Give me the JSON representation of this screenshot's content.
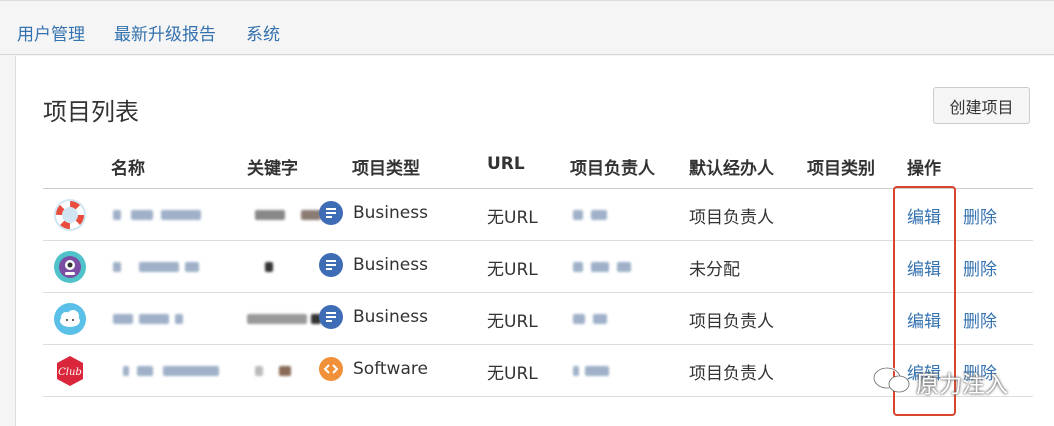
{
  "nav": {
    "items": [
      {
        "label": "用户管理"
      },
      {
        "label": "最新升级报告"
      },
      {
        "label": "系统"
      }
    ]
  },
  "page": {
    "title": "项目列表",
    "create_button": "创建项目"
  },
  "table": {
    "headers": {
      "name": "名称",
      "key": "关键字",
      "type": "项目类型",
      "url": "URL",
      "lead": "项目负责人",
      "assignee": "默认经办人",
      "category": "项目类别",
      "actions": "操作"
    },
    "rows": [
      {
        "avatar": "lifebuoy-avatar",
        "type": "Business",
        "type_icon": "business-icon",
        "url": "无URL",
        "assignee": "项目负责人",
        "edit": "编辑",
        "delete": "删除"
      },
      {
        "avatar": "robot-avatar",
        "type": "Business",
        "type_icon": "business-icon",
        "url": "无URL",
        "assignee": "未分配",
        "edit": "编辑",
        "delete": "删除"
      },
      {
        "avatar": "cloud-avatar",
        "type": "Business",
        "type_icon": "business-icon",
        "url": "无URL",
        "assignee": "项目负责人",
        "edit": "编辑",
        "delete": "删除"
      },
      {
        "avatar": "club-badge-avatar",
        "avatar_text": "Club",
        "type": "Software",
        "type_icon": "software-icon",
        "url": "无URL",
        "assignee": "项目负责人",
        "edit": "编辑",
        "delete": "删除"
      }
    ]
  },
  "watermark": {
    "text": "原力注入"
  },
  "colors": {
    "link": "#3572b0",
    "highlight": "#d9452c",
    "business_icon": "#3e6db5",
    "software_icon": "#f0913a"
  }
}
